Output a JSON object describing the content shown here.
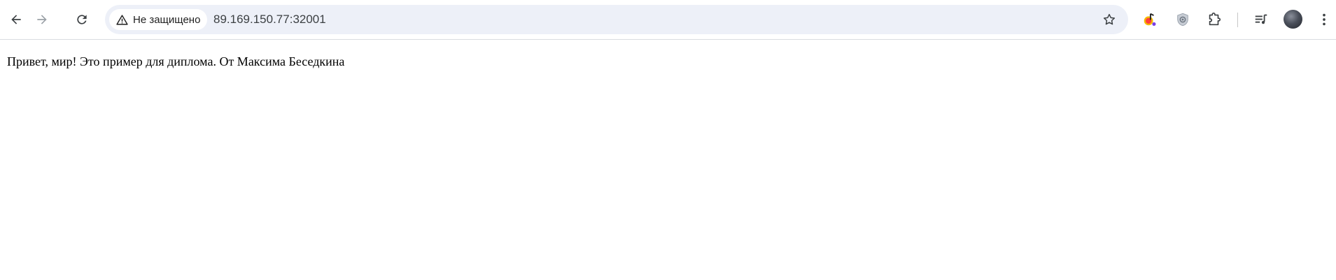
{
  "browser": {
    "security_label": "Не защищено",
    "url": "89.169.150.77:32001",
    "icons": {
      "back": "arrow-left-icon",
      "forward": "arrow-right-icon",
      "reload": "reload-icon",
      "security": "warning-triangle-icon",
      "bookmark": "star-icon",
      "extension_music": "music-extension-icon",
      "extension_shield": "shield-extension-icon",
      "extensions": "puzzle-icon",
      "media": "media-queue-icon",
      "profile": "avatar",
      "menu": "kebab-menu-icon"
    },
    "colors": {
      "omnibox_bg": "#edf0f8",
      "toolbar_icon": "#3c4043",
      "forward_disabled": "#9aa0a6"
    }
  },
  "page": {
    "text": "Привет, мир! Это пример для диплома. От Максима Беседкина"
  }
}
